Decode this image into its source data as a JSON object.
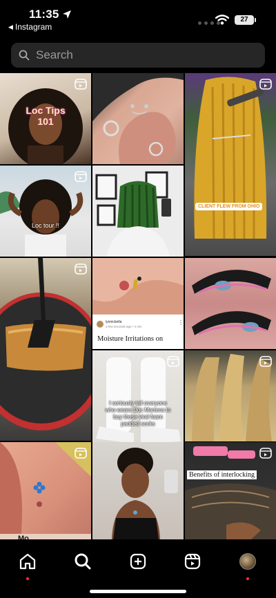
{
  "status_bar": {
    "time": "11:35",
    "back_app": "Instagram",
    "battery": "27"
  },
  "search": {
    "placeholder": "Search"
  },
  "tiles": {
    "loc_tips": "Loc Tips 101",
    "loc_tour": "Loc tour !!",
    "client_flew": "CLIENT FLEW FROM OHIO",
    "post_author": "lynnicbella",
    "post_meta": "a few seconds ago • 4 min",
    "post_title": "Moisture Irritations on",
    "socks_caption": "I seriously tell everyone who wears Doc Martens to buy these viral foam padded socks",
    "benefits": "Benefits of interlocking",
    "bottom_partial": "Mo"
  },
  "tabs": [
    "home",
    "search",
    "create",
    "reels",
    "profile"
  ]
}
